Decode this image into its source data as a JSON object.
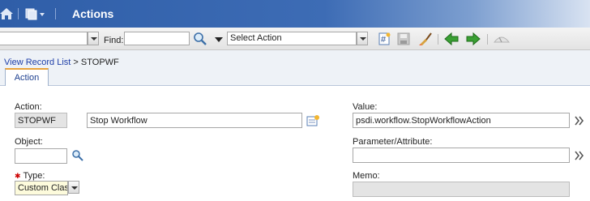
{
  "header": {
    "title": "Actions"
  },
  "toolbar": {
    "query_value": "",
    "find_label": "Find:",
    "find_value": "",
    "select_action": "Select Action"
  },
  "breadcrumb": {
    "link": "View Record List",
    "separator": ">",
    "current": "STOPWF"
  },
  "tabs": [
    {
      "label": "Action"
    }
  ],
  "form": {
    "action_label": "Action:",
    "action_value": "STOPWF",
    "description_value": "Stop Workflow",
    "object_label": "Object:",
    "object_value": "",
    "type_label": "Type:",
    "type_required_marker": "✱",
    "type_value": "Custom Class",
    "value_label": "Value:",
    "value_value": "psdi.workflow.StopWorkflowAction",
    "param_label": "Parameter/Attribute:",
    "param_value": "",
    "memo_label": "Memo:",
    "memo_value": ""
  },
  "icons": [
    "home-icon",
    "goto-applications-icon",
    "search-icon",
    "new-record-icon",
    "save-icon",
    "clear-changes-icon",
    "previous-record-icon",
    "next-record-icon",
    "help-icon",
    "detail-menu-icon",
    "lookup-icon",
    "double-chevron-icon"
  ],
  "colors": {
    "title_bar": "#2f5ea8",
    "link": "#1e3fa8",
    "tab_accent": "#e9a33b",
    "required_bg": "#fdfbdc",
    "readonly_bg": "#e4e4e4"
  }
}
